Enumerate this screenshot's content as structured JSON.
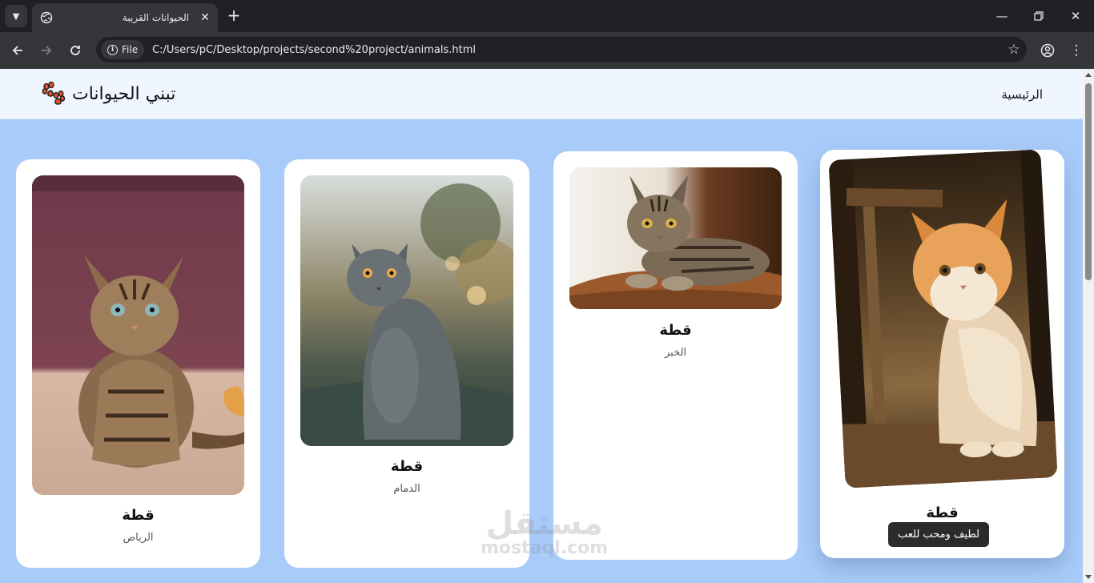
{
  "browser": {
    "tab_title": "الحيوانات القريبة",
    "file_chip": "File",
    "url": "C:/Users/pC/Desktop/projects/second%20project/animals.html"
  },
  "site": {
    "nav_home": "الرئيسية",
    "brand_title": "تبني الحيوانات",
    "brand_icon": "paw-icon"
  },
  "cards": [
    {
      "title": "قطة",
      "city": "الرياض",
      "photo": "tabby-kitten"
    },
    {
      "title": "قطة",
      "city": "الدمام",
      "photo": "grey-cat"
    },
    {
      "title": "قطة",
      "city": "الخبر",
      "photo": "tabby-cat-lying"
    },
    {
      "title": "قطة",
      "city": "",
      "photo": "orange-fluffy-cat",
      "tooltip": "لطيف ومحب للعب"
    }
  ],
  "watermark": {
    "arabic": "مستقل",
    "latin": "mostaql.com"
  },
  "colors": {
    "page_bg": "#a8cbf9",
    "header_bg": "#f0f6ff",
    "card_bg": "#ffffff",
    "tooltip_bg": "#2b2b2b"
  }
}
